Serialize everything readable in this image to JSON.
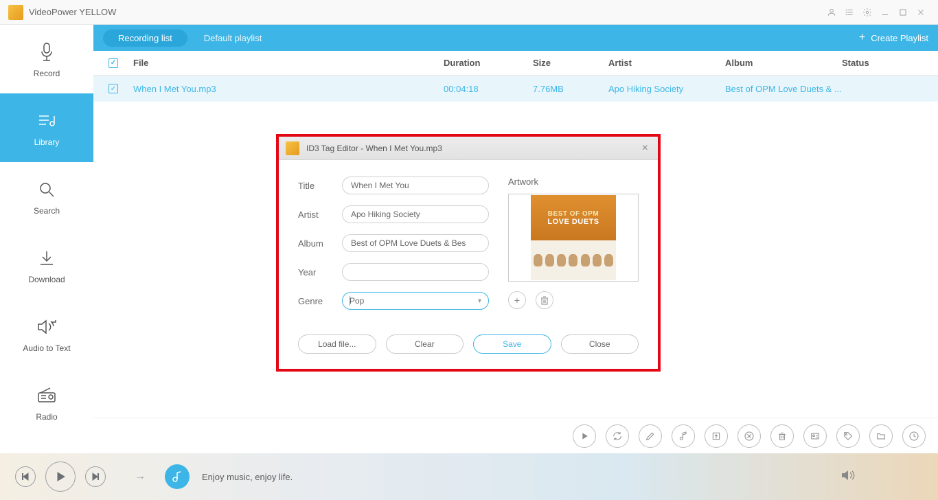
{
  "app": {
    "title": "VideoPower YELLOW"
  },
  "sidebar": {
    "items": [
      {
        "label": "Record"
      },
      {
        "label": "Library"
      },
      {
        "label": "Search"
      },
      {
        "label": "Download"
      },
      {
        "label": "Audio to Text"
      },
      {
        "label": "Radio"
      }
    ]
  },
  "tabs": {
    "recording_list": "Recording list",
    "default_playlist": "Default playlist",
    "create_playlist": "Create Playlist"
  },
  "table": {
    "headers": {
      "file": "File",
      "duration": "Duration",
      "size": "Size",
      "artist": "Artist",
      "album": "Album",
      "status": "Status"
    },
    "rows": [
      {
        "file": "When I Met You.mp3",
        "duration": "00:04:18",
        "size": "7.76MB",
        "artist": "Apo Hiking Society",
        "album": "Best of OPM Love Duets & ..."
      }
    ]
  },
  "dialog": {
    "title": "ID3 Tag Editor - When I Met You.mp3",
    "labels": {
      "title": "Title",
      "artist": "Artist",
      "album": "Album",
      "year": "Year",
      "genre": "Genre",
      "artwork": "Artwork"
    },
    "values": {
      "title": "When I Met You",
      "artist": "Apo Hiking Society",
      "album": "Best of OPM Love Duets & Bes",
      "year": "",
      "genre": "Pop"
    },
    "artwork_text": {
      "line1": "BEST OF OPM",
      "line2": "LOVE DUETS"
    },
    "buttons": {
      "load": "Load file...",
      "clear": "Clear",
      "save": "Save",
      "close": "Close"
    }
  },
  "player": {
    "tagline": "Enjoy music, enjoy life."
  }
}
